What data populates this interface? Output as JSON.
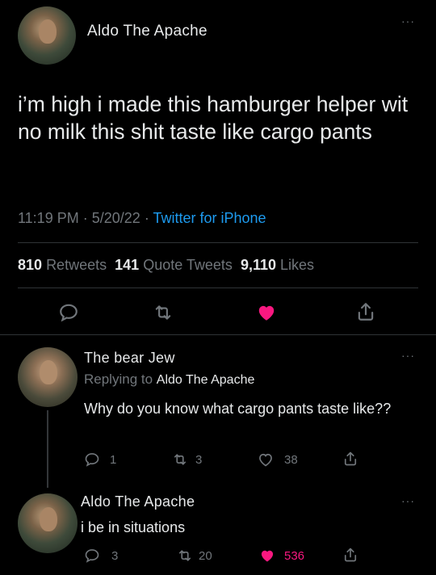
{
  "main_tweet": {
    "author_name": "Aldo The Apache",
    "text": "i’m high i made this hamburger helper wit no milk this shit taste like cargo pants",
    "time": "11:19 PM",
    "date": "5/20/22",
    "source": "Twitter for iPhone",
    "retweets_count": "810",
    "retweets_label": "Retweets",
    "quotes_count": "141",
    "quotes_label": "Quote Tweets",
    "likes_count": "9,110",
    "likes_label": "Likes",
    "liked": true,
    "like_color": "#f91880"
  },
  "replies": [
    {
      "author_name": "The bear Jew",
      "replying_prefix": "Replying to",
      "replying_to": "Aldo The Apache",
      "text": "Why do you know what cargo pants taste like??",
      "reply_count": "1",
      "retweet_count": "3",
      "like_count": "38",
      "liked": false
    },
    {
      "author_name": "Aldo The Apache",
      "text": "i be in situations",
      "reply_count": "3",
      "retweet_count": "20",
      "like_count": "536",
      "liked": true
    }
  ],
  "icons": {
    "reply": "reply-icon",
    "retweet": "retweet-icon",
    "like": "heart-icon",
    "share": "share-icon",
    "more": "more-icon"
  },
  "colors": {
    "accent": "#1d9bf0",
    "like": "#f91880",
    "muted": "#71767b",
    "text": "#e7e9ea",
    "background": "#000000"
  }
}
